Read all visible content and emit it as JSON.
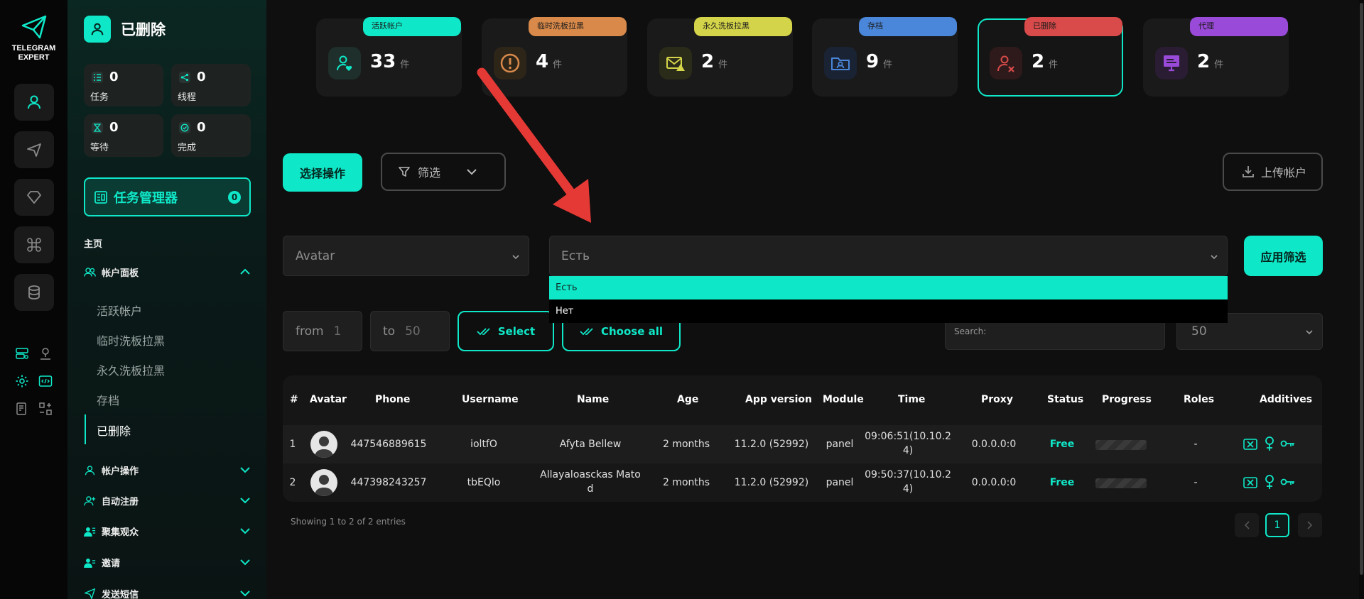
{
  "brand": {
    "line1": "TELEGRAM",
    "line2": "EXPERT"
  },
  "sidebar": {
    "title": "已删除",
    "stats": [
      {
        "num": "0",
        "label": "任务"
      },
      {
        "num": "0",
        "label": "线程"
      },
      {
        "num": "0",
        "label": "等待"
      },
      {
        "num": "0",
        "label": "完成"
      }
    ],
    "task_manager": {
      "label": "任务管理器",
      "count": "0"
    },
    "home": "主页",
    "groups": [
      {
        "label": "帐户面板"
      },
      {
        "label": "帐户操作"
      },
      {
        "label": "自动注册"
      },
      {
        "label": "聚集观众"
      },
      {
        "label": "邀请"
      },
      {
        "label": "发送短信"
      }
    ],
    "sub_items": [
      "活跃帐户",
      "临时洗板拉黑",
      "永久洗板拉黑",
      "存档",
      "已删除"
    ]
  },
  "cards": [
    {
      "pill": "活跃帐户",
      "num": "33",
      "unit": "件",
      "color": "#0fe8c8"
    },
    {
      "pill": "临时洗板拉黑",
      "num": "4",
      "unit": "件",
      "color": "#d98a4a"
    },
    {
      "pill": "永久洗板拉黑",
      "num": "2",
      "unit": "件",
      "color": "#d4d44a"
    },
    {
      "pill": "存档",
      "num": "9",
      "unit": "件",
      "color": "#4a86d9"
    },
    {
      "pill": "已删除",
      "num": "2",
      "unit": "件",
      "color": "#d94a4a"
    },
    {
      "pill": "代理",
      "num": "2",
      "unit": "件",
      "color": "#9a4ad9"
    }
  ],
  "toolbar": {
    "select_action": "选择操作",
    "filter": "筛选",
    "upload": "上传帐户"
  },
  "filter_row": {
    "field_select": "Avatar",
    "value_select": "Есть",
    "apply": "应用筛选",
    "options": [
      "Есть",
      "Нет"
    ]
  },
  "range_row": {
    "from_label": "from",
    "from_value": "1",
    "to_label": "to",
    "to_value": "50",
    "select_btn": "Select",
    "choose_all_btn": "Choose all",
    "search_placeholder": "Search:",
    "page_size": "50"
  },
  "table": {
    "headers": [
      "#",
      "Avatar",
      "Phone",
      "Username",
      "Name",
      "Age",
      "App version",
      "Module",
      "Time",
      "Proxy",
      "Status",
      "Progress",
      "Roles",
      "Additives"
    ],
    "rows": [
      {
        "idx": "1",
        "phone": "447546889615",
        "username": "ioltfO",
        "name": "Afyta Bellew",
        "name2": "",
        "age": "2 months",
        "app": "11.2.0 (52992)",
        "module": "panel",
        "time1": "09:06:51(10.10.2",
        "time2": "4)",
        "proxy": "0.0.0.0:0",
        "status": "Free",
        "roles": "-"
      },
      {
        "idx": "2",
        "phone": "447398243257",
        "username": "tbEQlo",
        "name": "Allayaloasckas Mato",
        "name2": "d",
        "age": "2 months",
        "app": "11.2.0 (52992)",
        "module": "panel",
        "time1": "09:50:37(10.10.2",
        "time2": "4)",
        "proxy": "0.0.0.0:0",
        "status": "Free",
        "roles": "-"
      }
    ],
    "footer": "Showing 1 to 2 of 2 entries",
    "current_page": "1"
  }
}
